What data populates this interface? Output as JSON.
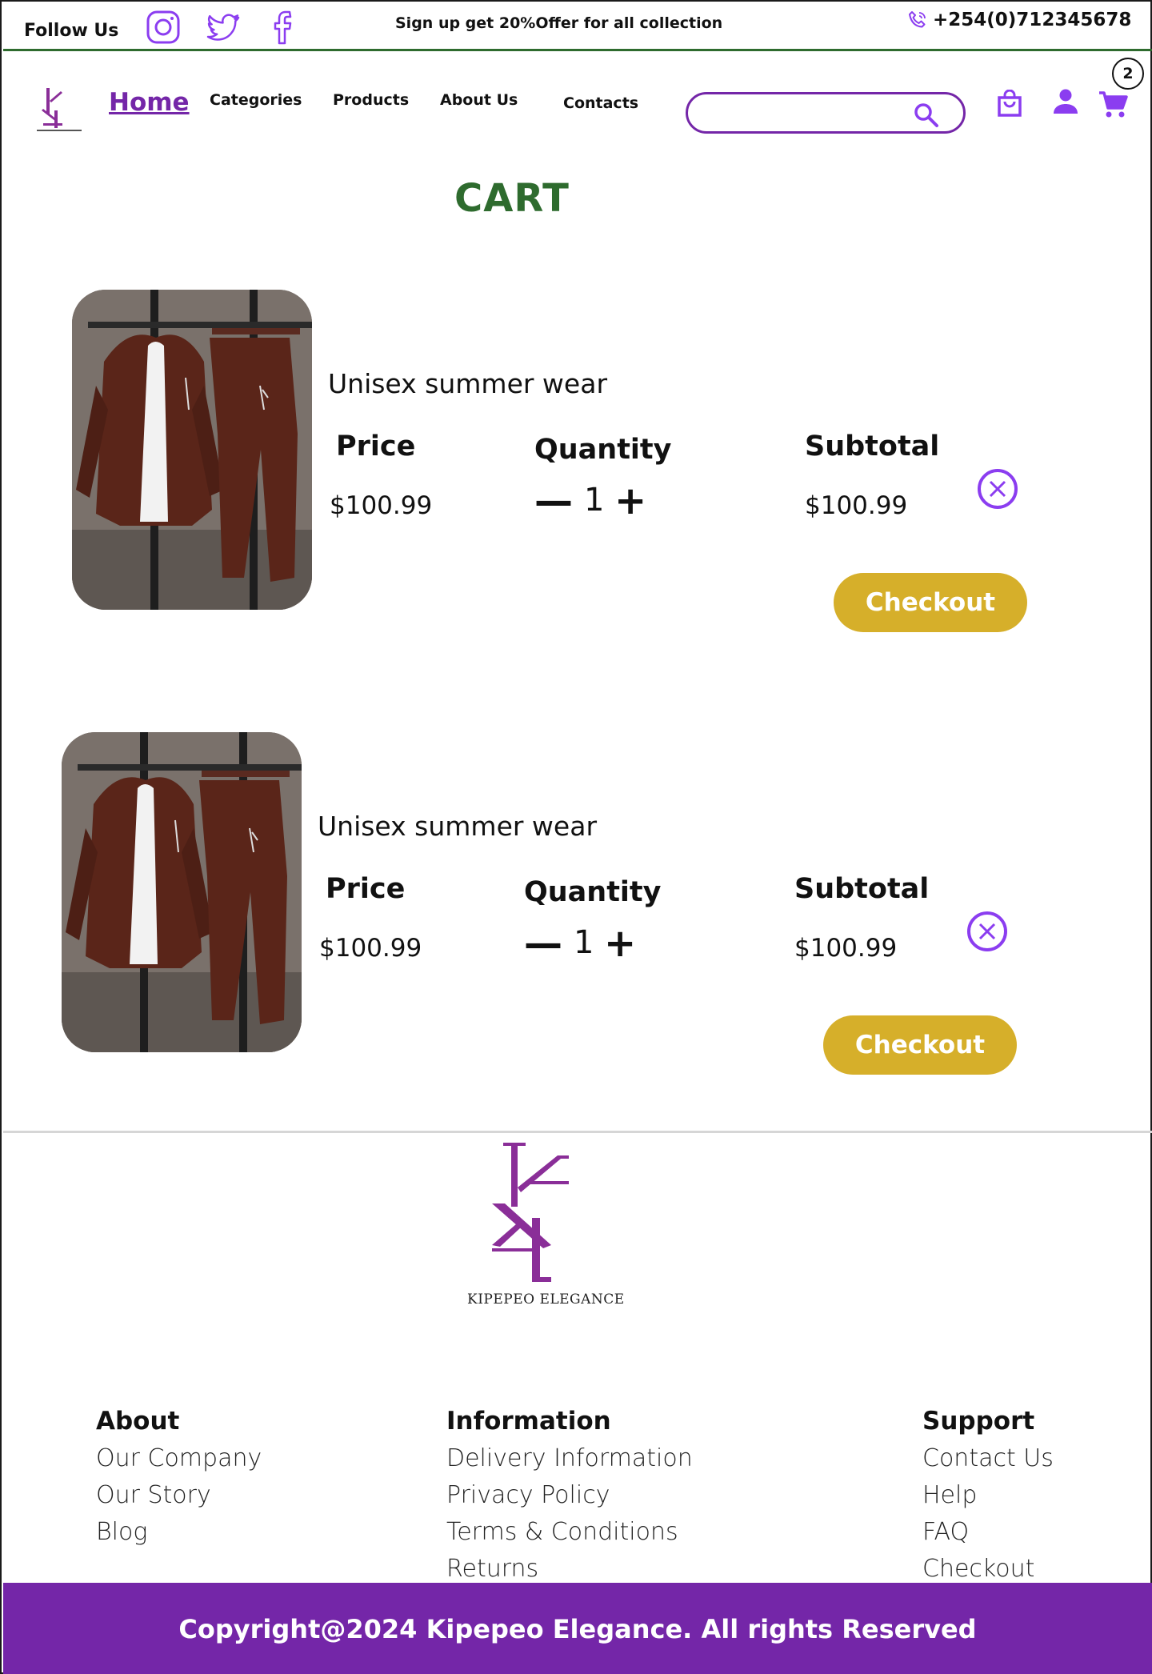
{
  "topbar": {
    "follow_label": "Follow Us",
    "social_icons": [
      "instagram-icon",
      "twitter-icon",
      "facebook-icon"
    ],
    "promo": "Sign up get 20%Offer for all collection",
    "phone": "+254(0)712345678"
  },
  "nav": {
    "home": "Home",
    "categories": "Categories",
    "products": "Products",
    "about": "About Us",
    "contacts": "Contacts",
    "search_placeholder": "",
    "cart_count": "2"
  },
  "page_title": "CART",
  "cart_items": [
    {
      "name": "Unisex summer wear",
      "price_label": "Price",
      "price": "$100.99",
      "quantity_label": "Quantity",
      "quantity": "1",
      "minus": "—",
      "plus": "+",
      "subtotal_label": "Subtotal",
      "subtotal": "$100.99",
      "checkout_label": "Checkout"
    },
    {
      "name": "Unisex summer wear",
      "price_label": "Price",
      "price": "$100.99",
      "quantity_label": "Quantity",
      "quantity": "1",
      "minus": "—",
      "plus": "+",
      "subtotal_label": "Subtotal",
      "subtotal": "$100.99",
      "checkout_label": "Checkout"
    }
  ],
  "footer": {
    "brand": "KIPEPEO ELEGANCE",
    "columns": [
      {
        "heading": "About",
        "items": [
          "Our Company",
          "Our Story",
          "Blog"
        ]
      },
      {
        "heading": "Information",
        "items": [
          "Delivery Information",
          "Privacy Policy",
          "Terms & Conditions",
          "Returns"
        ]
      },
      {
        "heading": "Support",
        "items": [
          "Contact Us",
          "Help",
          "FAQ",
          "Checkout"
        ]
      }
    ],
    "copyright": "Copyright@2024 Kipepeo Elegance. All rights Reserved"
  },
  "colors": {
    "accent_purple": "#7426a8",
    "icon_purple": "#8b3df0",
    "brand_green": "#2e6b2e",
    "checkout_gold": "#d6af2a"
  }
}
